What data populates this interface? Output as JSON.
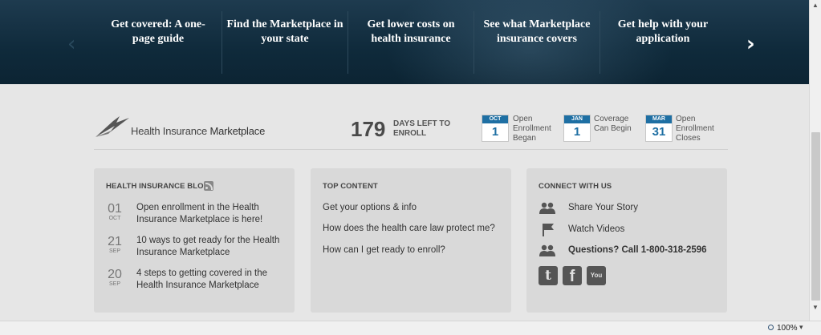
{
  "banner": {
    "items": [
      {
        "line1": "Get covered: A one-",
        "line2": "page guide"
      },
      {
        "line1": "Find the Marketplace in",
        "line2": "your state"
      },
      {
        "line1": "Get lower costs on",
        "line2": "health insurance"
      },
      {
        "line1": "See what Marketplace",
        "line2": "insurance covers"
      },
      {
        "line1": "Get help with your",
        "line2": "application"
      }
    ],
    "prev_glyph": "‹",
    "next_glyph": "›"
  },
  "logo": {
    "text_light": "Health Insurance ",
    "text_bold": "Marketplace"
  },
  "countdown": {
    "days": "179",
    "label": "DAYS LEFT TO ENROLL"
  },
  "calendar": [
    {
      "month": "OCT",
      "day": "1",
      "label_lines": [
        "Open",
        "Enrollment",
        "Began"
      ]
    },
    {
      "month": "JAN",
      "day": "1",
      "label_lines": [
        "Coverage",
        "Can Begin"
      ]
    },
    {
      "month": "MAR",
      "day": "31",
      "label_lines": [
        "Open",
        "Enrollment",
        "Closes"
      ]
    }
  ],
  "blog": {
    "title": "HEALTH INSURANCE BLOG",
    "entries": [
      {
        "day": "01",
        "month": "OCT",
        "text": "Open enrollment in the Health Insurance Marketplace is here!"
      },
      {
        "day": "21",
        "month": "SEP",
        "text": "10 ways to get ready for the Health Insurance Marketplace"
      },
      {
        "day": "20",
        "month": "SEP",
        "text": "4 steps to getting covered in the Health Insurance Marketplace"
      }
    ]
  },
  "top_content": {
    "title": "TOP CONTENT",
    "links": [
      "Get your options & info",
      "How does the health care law protect me?",
      "How can I get ready to enroll?"
    ]
  },
  "connect": {
    "title": "CONNECT WITH US",
    "items": [
      {
        "icon": "people-icon",
        "text": "Share Your Story"
      },
      {
        "icon": "flag-icon",
        "text": "Watch Videos"
      },
      {
        "icon": "people-icon",
        "text": "Questions? Call 1-800-318-2596"
      }
    ],
    "social": [
      {
        "icon": "twitter-icon",
        "glyph": "t"
      },
      {
        "icon": "facebook-icon",
        "glyph": "f"
      },
      {
        "icon": "youtube-icon",
        "glyph": "You"
      }
    ]
  },
  "statusbar": {
    "zoom": "100%",
    "caret": "▾"
  },
  "colors": {
    "banner_bg": "#0f2a3b",
    "accent_blue": "#1e6fa3",
    "card_bg": "#d9d9d9",
    "page_bg": "#e6e6e6"
  }
}
